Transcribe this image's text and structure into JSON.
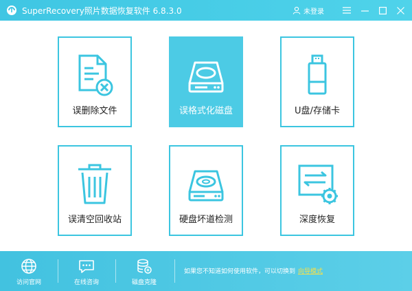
{
  "titlebar": {
    "title": "SuperRecovery照片数据恢复软件 6.8.3.0",
    "login_label": "未登录",
    "controls": [
      "menu",
      "minimize",
      "maximize",
      "close"
    ]
  },
  "tiles": [
    {
      "label": "误删除文件",
      "icon": "file-delete-icon",
      "active": false
    },
    {
      "label": "误格式化磁盘",
      "icon": "hard-disk-icon",
      "active": true
    },
    {
      "label": "U盘/存储卡",
      "icon": "usb-drive-icon",
      "active": false
    },
    {
      "label": "误清空回收站",
      "icon": "trash-bin-icon",
      "active": false
    },
    {
      "label": "硬盘坏道检测",
      "icon": "disk-scan-icon",
      "active": false
    },
    {
      "label": "深度恢复",
      "icon": "deep-recovery-icon",
      "active": false
    }
  ],
  "bottom": {
    "items": [
      {
        "label": "访问官网",
        "icon": "globe-icon"
      },
      {
        "label": "在线咨询",
        "icon": "chat-icon"
      },
      {
        "label": "磁盘克隆",
        "icon": "database-clone-icon"
      }
    ],
    "hint": "如果您不知道如何使用软件，可以切换到",
    "link": "向导模式"
  },
  "colors": {
    "accent": "#3bc5e0",
    "active_tile": "#4ccbe5",
    "link": "#f5e04a"
  }
}
